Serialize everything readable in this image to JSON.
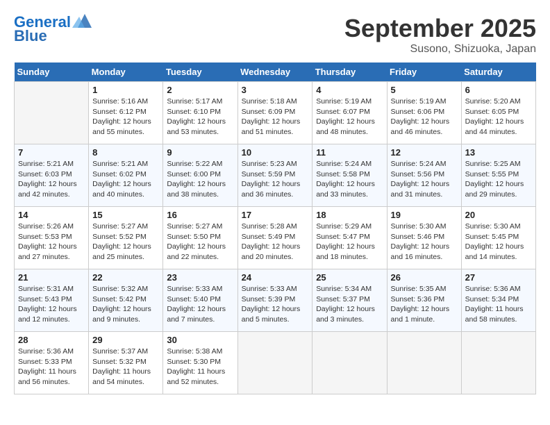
{
  "header": {
    "logo_line1": "General",
    "logo_line2": "Blue",
    "month": "September 2025",
    "location": "Susono, Shizuoka, Japan"
  },
  "days_of_week": [
    "Sunday",
    "Monday",
    "Tuesday",
    "Wednesday",
    "Thursday",
    "Friday",
    "Saturday"
  ],
  "weeks": [
    [
      {
        "day": "",
        "detail": ""
      },
      {
        "day": "1",
        "detail": "Sunrise: 5:16 AM\nSunset: 6:12 PM\nDaylight: 12 hours\nand 55 minutes."
      },
      {
        "day": "2",
        "detail": "Sunrise: 5:17 AM\nSunset: 6:10 PM\nDaylight: 12 hours\nand 53 minutes."
      },
      {
        "day": "3",
        "detail": "Sunrise: 5:18 AM\nSunset: 6:09 PM\nDaylight: 12 hours\nand 51 minutes."
      },
      {
        "day": "4",
        "detail": "Sunrise: 5:19 AM\nSunset: 6:07 PM\nDaylight: 12 hours\nand 48 minutes."
      },
      {
        "day": "5",
        "detail": "Sunrise: 5:19 AM\nSunset: 6:06 PM\nDaylight: 12 hours\nand 46 minutes."
      },
      {
        "day": "6",
        "detail": "Sunrise: 5:20 AM\nSunset: 6:05 PM\nDaylight: 12 hours\nand 44 minutes."
      }
    ],
    [
      {
        "day": "7",
        "detail": "Sunrise: 5:21 AM\nSunset: 6:03 PM\nDaylight: 12 hours\nand 42 minutes."
      },
      {
        "day": "8",
        "detail": "Sunrise: 5:21 AM\nSunset: 6:02 PM\nDaylight: 12 hours\nand 40 minutes."
      },
      {
        "day": "9",
        "detail": "Sunrise: 5:22 AM\nSunset: 6:00 PM\nDaylight: 12 hours\nand 38 minutes."
      },
      {
        "day": "10",
        "detail": "Sunrise: 5:23 AM\nSunset: 5:59 PM\nDaylight: 12 hours\nand 36 minutes."
      },
      {
        "day": "11",
        "detail": "Sunrise: 5:24 AM\nSunset: 5:58 PM\nDaylight: 12 hours\nand 33 minutes."
      },
      {
        "day": "12",
        "detail": "Sunrise: 5:24 AM\nSunset: 5:56 PM\nDaylight: 12 hours\nand 31 minutes."
      },
      {
        "day": "13",
        "detail": "Sunrise: 5:25 AM\nSunset: 5:55 PM\nDaylight: 12 hours\nand 29 minutes."
      }
    ],
    [
      {
        "day": "14",
        "detail": "Sunrise: 5:26 AM\nSunset: 5:53 PM\nDaylight: 12 hours\nand 27 minutes."
      },
      {
        "day": "15",
        "detail": "Sunrise: 5:27 AM\nSunset: 5:52 PM\nDaylight: 12 hours\nand 25 minutes."
      },
      {
        "day": "16",
        "detail": "Sunrise: 5:27 AM\nSunset: 5:50 PM\nDaylight: 12 hours\nand 22 minutes."
      },
      {
        "day": "17",
        "detail": "Sunrise: 5:28 AM\nSunset: 5:49 PM\nDaylight: 12 hours\nand 20 minutes."
      },
      {
        "day": "18",
        "detail": "Sunrise: 5:29 AM\nSunset: 5:47 PM\nDaylight: 12 hours\nand 18 minutes."
      },
      {
        "day": "19",
        "detail": "Sunrise: 5:30 AM\nSunset: 5:46 PM\nDaylight: 12 hours\nand 16 minutes."
      },
      {
        "day": "20",
        "detail": "Sunrise: 5:30 AM\nSunset: 5:45 PM\nDaylight: 12 hours\nand 14 minutes."
      }
    ],
    [
      {
        "day": "21",
        "detail": "Sunrise: 5:31 AM\nSunset: 5:43 PM\nDaylight: 12 hours\nand 12 minutes."
      },
      {
        "day": "22",
        "detail": "Sunrise: 5:32 AM\nSunset: 5:42 PM\nDaylight: 12 hours\nand 9 minutes."
      },
      {
        "day": "23",
        "detail": "Sunrise: 5:33 AM\nSunset: 5:40 PM\nDaylight: 12 hours\nand 7 minutes."
      },
      {
        "day": "24",
        "detail": "Sunrise: 5:33 AM\nSunset: 5:39 PM\nDaylight: 12 hours\nand 5 minutes."
      },
      {
        "day": "25",
        "detail": "Sunrise: 5:34 AM\nSunset: 5:37 PM\nDaylight: 12 hours\nand 3 minutes."
      },
      {
        "day": "26",
        "detail": "Sunrise: 5:35 AM\nSunset: 5:36 PM\nDaylight: 12 hours\nand 1 minute."
      },
      {
        "day": "27",
        "detail": "Sunrise: 5:36 AM\nSunset: 5:34 PM\nDaylight: 11 hours\nand 58 minutes."
      }
    ],
    [
      {
        "day": "28",
        "detail": "Sunrise: 5:36 AM\nSunset: 5:33 PM\nDaylight: 11 hours\nand 56 minutes."
      },
      {
        "day": "29",
        "detail": "Sunrise: 5:37 AM\nSunset: 5:32 PM\nDaylight: 11 hours\nand 54 minutes."
      },
      {
        "day": "30",
        "detail": "Sunrise: 5:38 AM\nSunset: 5:30 PM\nDaylight: 11 hours\nand 52 minutes."
      },
      {
        "day": "",
        "detail": ""
      },
      {
        "day": "",
        "detail": ""
      },
      {
        "day": "",
        "detail": ""
      },
      {
        "day": "",
        "detail": ""
      }
    ]
  ]
}
